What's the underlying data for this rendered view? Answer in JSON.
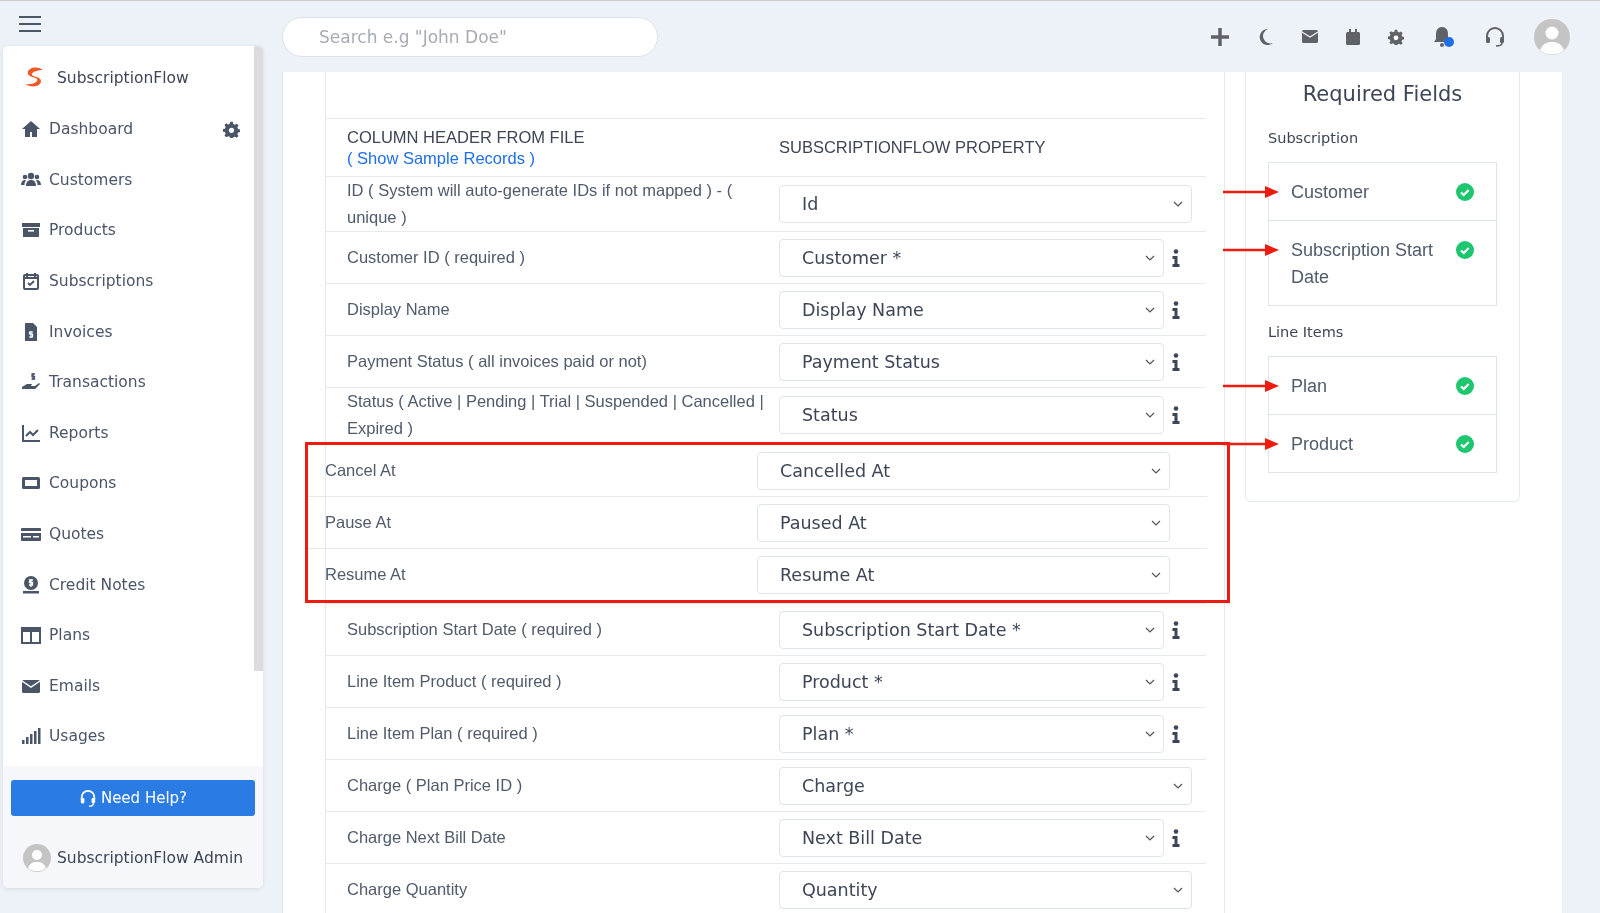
{
  "topbar": {
    "search": {
      "placeholder": "Search e.g \"John Doe\""
    }
  },
  "sidebar": {
    "brand": "SubscriptionFlow",
    "items": [
      {
        "label": "Dashboard",
        "settings": true
      },
      {
        "label": "Customers",
        "settings": false
      },
      {
        "label": "Products",
        "settings": false
      },
      {
        "label": "Subscriptions",
        "settings": false
      },
      {
        "label": "Invoices",
        "settings": false
      },
      {
        "label": "Transactions",
        "settings": false
      },
      {
        "label": "Reports",
        "settings": false
      },
      {
        "label": "Coupons",
        "settings": false
      },
      {
        "label": "Quotes",
        "settings": false
      },
      {
        "label": "Credit Notes",
        "settings": false
      },
      {
        "label": "Plans",
        "settings": false
      },
      {
        "label": "Emails",
        "settings": false
      },
      {
        "label": "Usages",
        "settings": false
      }
    ],
    "help_button": "Need Help?",
    "user": "SubscriptionFlow Admin"
  },
  "mapping": {
    "header_left": "COLUMN HEADER FROM FILE",
    "header_link": "( Show Sample Records )",
    "header_right": "SUBSCRIPTIONFLOW PROPERTY",
    "rows": [
      {
        "label": "ID ( System will auto-generate IDs if not mapped ) - ( unique )",
        "value": "Id",
        "info": false,
        "highlighted": false
      },
      {
        "label": "Customer ID ( required )",
        "value": "Customer *",
        "info": true,
        "highlighted": false
      },
      {
        "label": "Display Name",
        "value": "Display Name",
        "info": true,
        "highlighted": false
      },
      {
        "label": "Payment Status ( all invoices paid or not)",
        "value": "Payment Status",
        "info": true,
        "highlighted": false
      },
      {
        "label": "Status ( Active | Pending | Trial | Suspended | Cancelled | Expired )",
        "value": "Status",
        "info": true,
        "highlighted": false
      },
      {
        "label": "Cancel At",
        "value": "Cancelled At",
        "info": false,
        "highlighted": true
      },
      {
        "label": "Pause At",
        "value": "Paused At",
        "info": false,
        "highlighted": true
      },
      {
        "label": "Resume At",
        "value": "Resume At",
        "info": false,
        "highlighted": true
      },
      {
        "label": "Subscription Start Date ( required )",
        "value": "Subscription Start Date *",
        "info": true,
        "highlighted": false
      },
      {
        "label": "Line Item Product ( required )",
        "value": "Product *",
        "info": true,
        "highlighted": false
      },
      {
        "label": "Line Item Plan ( required )",
        "value": "Plan *",
        "info": true,
        "highlighted": false
      },
      {
        "label": "Charge ( Plan Price ID )",
        "value": "Charge",
        "info": false,
        "highlighted": false
      },
      {
        "label": "Charge Next Bill Date",
        "value": "Next Bill Date",
        "info": true,
        "highlighted": false
      },
      {
        "label": "Charge Quantity",
        "value": "Quantity",
        "info": false,
        "highlighted": false
      }
    ]
  },
  "required_fields": {
    "title": "Required Fields",
    "groups": [
      {
        "name": "Subscription",
        "items": [
          {
            "label": "Customer",
            "checked": true,
            "arrow": true
          },
          {
            "label": "Subscription Start Date",
            "checked": true,
            "arrow": true
          }
        ]
      },
      {
        "name": "Line Items",
        "items": [
          {
            "label": "Plan",
            "checked": true,
            "arrow": true
          },
          {
            "label": "Product",
            "checked": true,
            "arrow": true
          }
        ]
      }
    ]
  }
}
